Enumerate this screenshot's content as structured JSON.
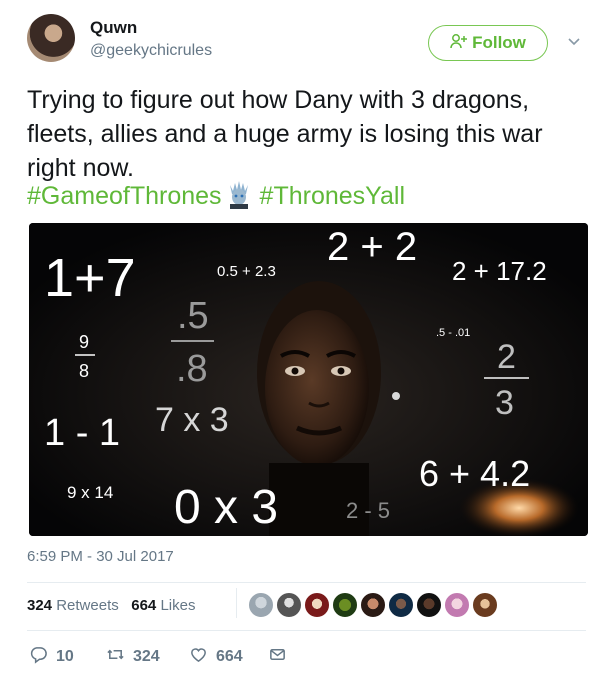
{
  "author": {
    "display_name": "Quwn",
    "handle": "@geekychicrules"
  },
  "follow_button": {
    "label": "Follow",
    "icon": "add-user-icon"
  },
  "tweet": {
    "text": "Trying to figure out how Dany with 3 dragons, fleets, allies and a huge army is losing this war right now.",
    "hashtags": [
      "#GameofThrones",
      "#ThronesYall"
    ],
    "hashtag_emoji": "night-king-icon"
  },
  "image": {
    "equations": [
      "1+7",
      "0.5 + 2.3",
      "2 + 2",
      "2 + 17.2",
      ".5",
      ".8",
      "9",
      "8",
      ".5 - .01",
      "2",
      "3",
      "1 - 1",
      "7 x 3",
      "6 + 4.2",
      "9 x 14",
      "0 x 3",
      "2 - 5"
    ]
  },
  "timestamp": "6:59 PM - 30 Jul 2017",
  "stats": {
    "retweets_count": "324",
    "retweets_label": "Retweets",
    "likes_count": "664",
    "likes_label": "Likes"
  },
  "actions": {
    "reply_count": "10",
    "retweet_count": "324",
    "like_count": "664"
  },
  "colors": {
    "accent_green": "#5fb838",
    "muted": "#657786"
  }
}
